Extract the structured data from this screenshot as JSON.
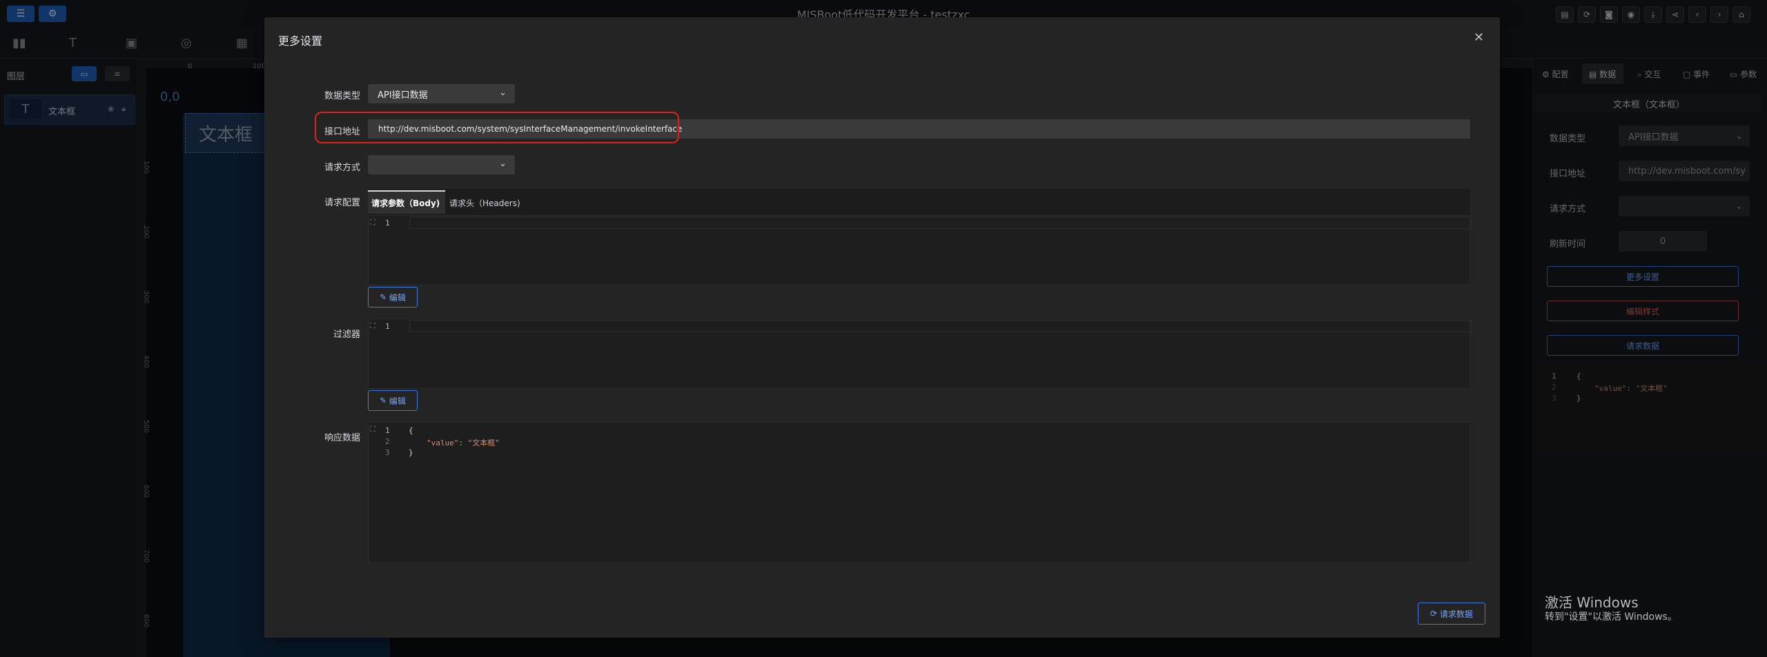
{
  "window": {
    "title": "MISBoot低代码开发平台 - testzxc"
  },
  "canvas": {
    "origin": "0,0",
    "element_text": "文本框"
  },
  "left_panel": {
    "header": "图层",
    "layers": [
      {
        "name": "文本框",
        "icon": "T"
      }
    ]
  },
  "rulers": {
    "h_ticks": [
      "0",
      "100"
    ],
    "v_ticks": [
      "100",
      "200",
      "300",
      "400",
      "500",
      "600",
      "700",
      "800"
    ]
  },
  "right_panel": {
    "tabs": [
      "配置",
      "数据",
      "交互",
      "事件",
      "参数"
    ],
    "component_title": "文本框（文本框）",
    "fields": [
      {
        "label": "数据类型",
        "value": "API接口数据"
      },
      {
        "label": "接口地址",
        "value": "http://dev.misboot.com/sy"
      },
      {
        "label": "请求方式",
        "value": ""
      },
      {
        "label": "刷新时间",
        "value": "0"
      }
    ],
    "buttons": {
      "more": "更多设置",
      "style": "编辑样式",
      "request": "请求数据"
    },
    "code": [
      "{",
      "\"value\": \"文本框\"",
      "}"
    ]
  },
  "modal": {
    "title": "更多设置",
    "data_type_label": "数据类型",
    "data_type_value": "API接口数据",
    "url_label": "接口地址",
    "url_value": "http://dev.misboot.com/system/sysInterfaceManagement/invokeInterface",
    "method_label": "请求方式",
    "method_value": "",
    "config_label": "请求配置",
    "config_tabs": [
      "请求参数（Body)",
      "请求头（Headers)"
    ],
    "edit_label": "编辑",
    "filter_label": "过滤器",
    "response_label": "响应数据",
    "response_code": [
      "{",
      "\"value\": \"文本框\"",
      "}"
    ],
    "request_button": "请求数据"
  },
  "watermark": {
    "line1": "激活 Windows",
    "line2": "转到\"设置\"以激活 Windows。"
  },
  "colors": {
    "accent": "#3b7be0",
    "highlight_ring": "#e02020",
    "danger": "#e06060"
  }
}
